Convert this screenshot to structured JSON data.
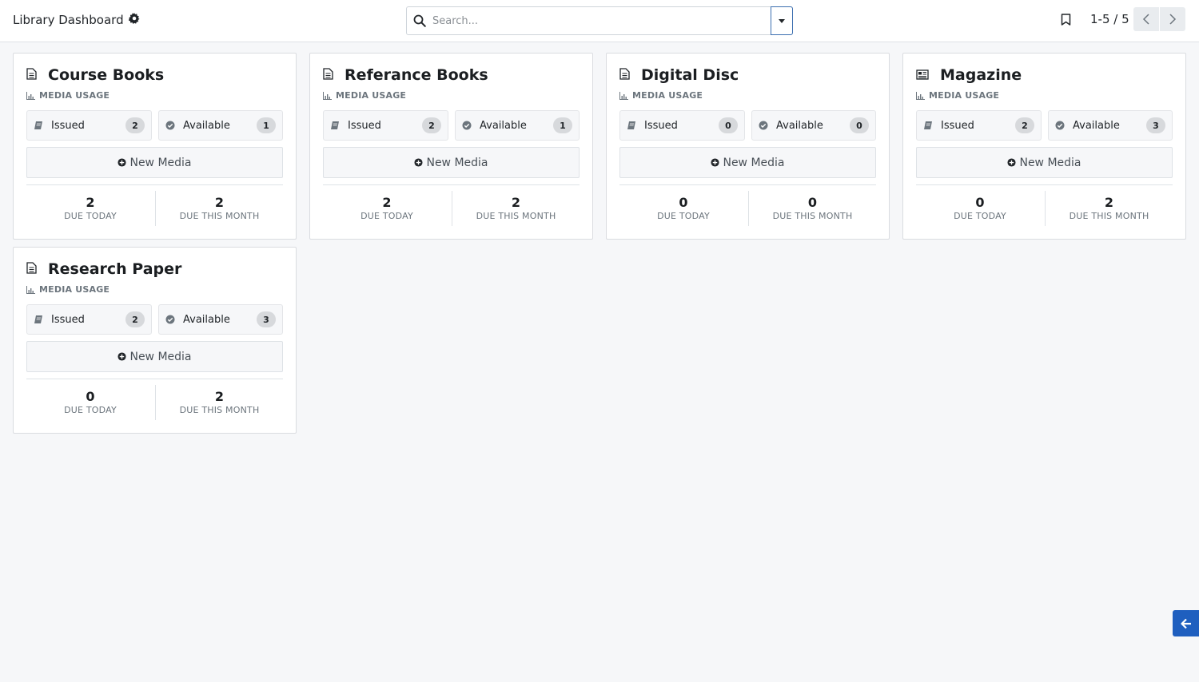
{
  "header": {
    "title": "Library Dashboard",
    "title_icon": "gear-icon",
    "search_placeholder": "Search...",
    "pager_text": "1-5 / 5"
  },
  "cards": [
    {
      "title": "Course Books",
      "icon": "document-icon",
      "subtitle": "MEDIA USAGE",
      "issued_label": "Issued",
      "issued_count": "2",
      "available_label": "Available",
      "available_count": "1",
      "new_media_label": "New Media",
      "due_today": "2",
      "due_today_label": "DUE TODAY",
      "due_month": "2",
      "due_month_label": "DUE THIS MONTH"
    },
    {
      "title": "Referance Books",
      "icon": "document-icon",
      "subtitle": "MEDIA USAGE",
      "issued_label": "Issued",
      "issued_count": "2",
      "available_label": "Available",
      "available_count": "1",
      "new_media_label": "New Media",
      "due_today": "2",
      "due_today_label": "DUE TODAY",
      "due_month": "2",
      "due_month_label": "DUE THIS MONTH"
    },
    {
      "title": "Digital Disc",
      "icon": "document-icon",
      "subtitle": "MEDIA USAGE",
      "issued_label": "Issued",
      "issued_count": "0",
      "available_label": "Available",
      "available_count": "0",
      "new_media_label": "New Media",
      "due_today": "0",
      "due_today_label": "DUE TODAY",
      "due_month": "0",
      "due_month_label": "DUE THIS MONTH"
    },
    {
      "title": "Magazine",
      "icon": "newspaper-icon",
      "subtitle": "MEDIA USAGE",
      "issued_label": "Issued",
      "issued_count": "2",
      "available_label": "Available",
      "available_count": "3",
      "new_media_label": "New Media",
      "due_today": "0",
      "due_today_label": "DUE TODAY",
      "due_month": "2",
      "due_month_label": "DUE THIS MONTH"
    },
    {
      "title": "Research Paper",
      "icon": "document-icon",
      "subtitle": "MEDIA USAGE",
      "issued_label": "Issued",
      "issued_count": "2",
      "available_label": "Available",
      "available_count": "3",
      "new_media_label": "New Media",
      "due_today": "0",
      "due_today_label": "DUE TODAY",
      "due_month": "2",
      "due_month_label": "DUE THIS MONTH"
    }
  ],
  "colors": {
    "accent": "#1f5fbf",
    "background": "#f6f7f9",
    "badge": "#d7d9dc"
  }
}
